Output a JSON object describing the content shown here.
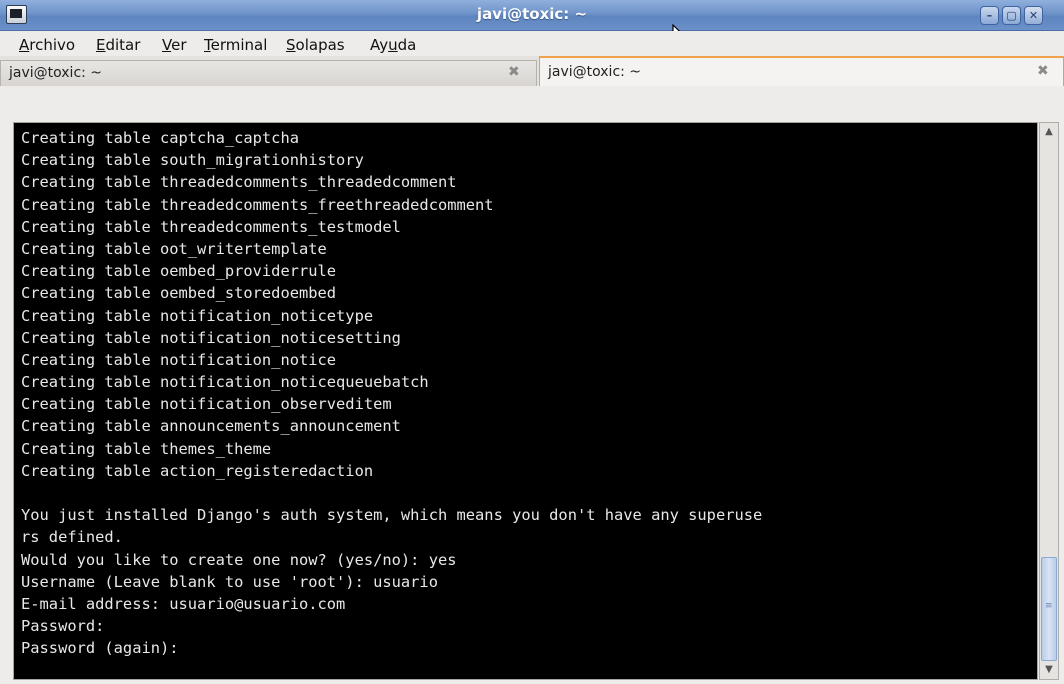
{
  "window": {
    "title": "javi@toxic: ~",
    "icons": {
      "app": "terminal-icon",
      "minimize": "minimize-icon",
      "maximize": "maximize-icon",
      "close": "close-icon"
    }
  },
  "menubar": {
    "items": [
      {
        "mnemonic": "A",
        "rest": "rchivo"
      },
      {
        "mnemonic": "E",
        "rest": "ditar"
      },
      {
        "mnemonic": "V",
        "rest": "er"
      },
      {
        "mnemonic": "T",
        "rest": "erminal"
      },
      {
        "mnemonic": "S",
        "rest": "olapas"
      },
      {
        "pre": "Ay",
        "mnemonic": "u",
        "rest": "da"
      }
    ]
  },
  "tabs": [
    {
      "label": "javi@toxic: ~",
      "close": "✖",
      "active": false
    },
    {
      "label": "javi@toxic: ~",
      "close": "✖",
      "active": true
    }
  ],
  "terminal": {
    "lines": [
      "Creating table captcha_captcha",
      "Creating table south_migrationhistory",
      "Creating table threadedcomments_threadedcomment",
      "Creating table threadedcomments_freethreadedcomment",
      "Creating table threadedcomments_testmodel",
      "Creating table oot_writertemplate",
      "Creating table oembed_providerrule",
      "Creating table oembed_storedoembed",
      "Creating table notification_noticetype",
      "Creating table notification_noticesetting",
      "Creating table notification_notice",
      "Creating table notification_noticequeuebatch",
      "Creating table notification_observeditem",
      "Creating table announcements_announcement",
      "Creating table themes_theme",
      "Creating table action_registeredaction",
      "",
      "You just installed Django's auth system, which means you don't have any superuse",
      "rs defined.",
      "Would you like to create one now? (yes/no): yes",
      "Username (Leave blank to use 'root'): usuario",
      "E-mail address: usuario@usuario.com",
      "Password:",
      "Password (again):"
    ]
  },
  "scrollbar": {
    "up": "▲",
    "down": "▼",
    "grip": "≡",
    "position_fraction": 0.8
  }
}
